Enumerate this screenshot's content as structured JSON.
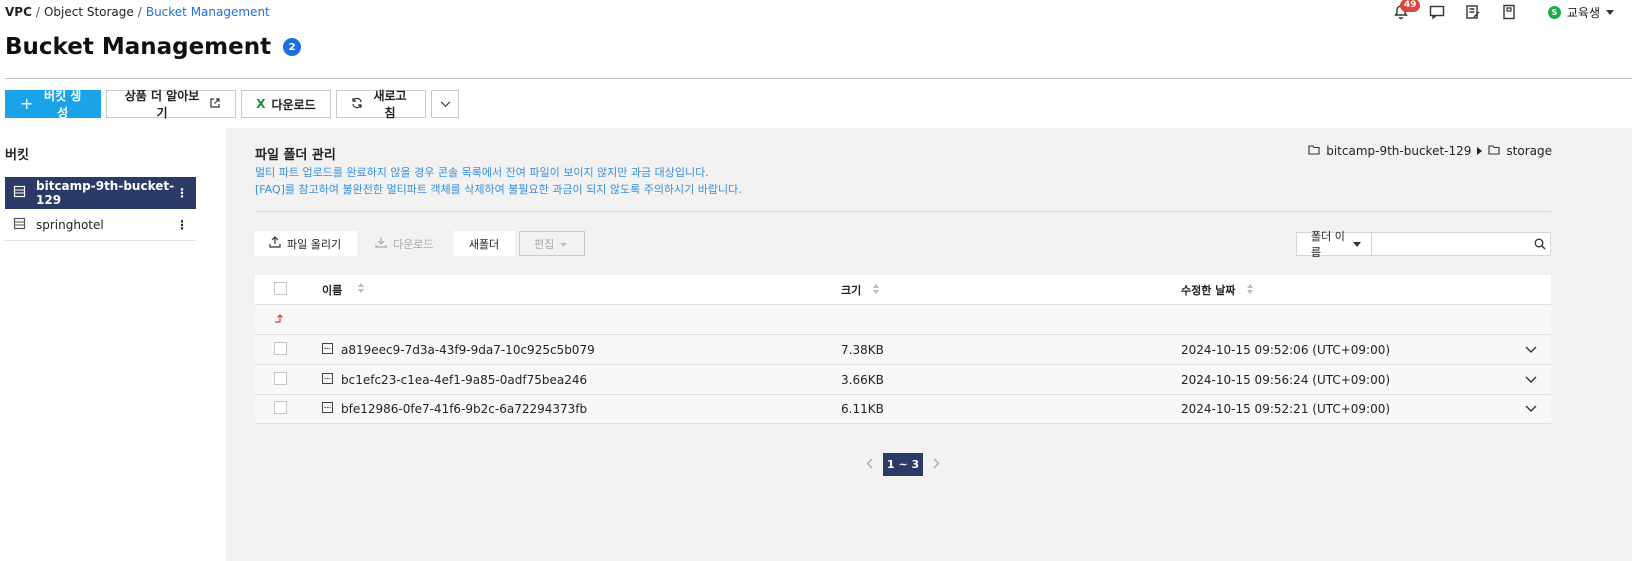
{
  "breadcrumb": [
    "VPC",
    "Object Storage",
    "Bucket Management"
  ],
  "header": {
    "notification_count": "49",
    "user_initial": "S",
    "user_name": "교육생"
  },
  "page": {
    "title": "Bucket Management",
    "badge": "2"
  },
  "toolbar": {
    "create": "버킷 생성",
    "learn_more": "상품 더 알아보기",
    "download": "다운로드",
    "refresh": "새로고침"
  },
  "sidebar": {
    "title": "버킷",
    "buckets": [
      {
        "name": "bitcamp-9th-bucket-129",
        "active": true
      },
      {
        "name": "springhotel",
        "active": false
      }
    ]
  },
  "main": {
    "section_title": "파일 폴더 관리",
    "notice_line1": "멀티 파트 업로드를 완료하지 않을 경우 콘솔 목록에서 잔여 파일이 보이지 않지만 과금 대상입니다.",
    "notice_line2": "[FAQ]를 참고하여 불완전한 멀티파트 객체를 삭제하여 불필요한 과금이 되지 않도록 주의하시기 바랍니다.",
    "path": [
      "bitcamp-9th-bucket-129",
      "storage"
    ],
    "actions": {
      "upload": "파일 올리기",
      "download": "다운로드",
      "new_folder": "새폴더",
      "edit": "편집"
    },
    "search": {
      "select": "폴더 이름",
      "value": ""
    },
    "table": {
      "headers": {
        "name": "이름",
        "size": "크기",
        "date": "수정한 날짜"
      },
      "rows": [
        {
          "name": "a819eec9-7d3a-43f9-9da7-10c925c5b079",
          "size": "7.38KB",
          "date": "2024-10-15 09:52:06 (UTC+09:00)"
        },
        {
          "name": "bc1efc23-c1ea-4ef1-9a85-0adf75bea246",
          "size": "3.66KB",
          "date": "2024-10-15 09:56:24 (UTC+09:00)"
        },
        {
          "name": "bfe12986-0fe7-41f6-9b2c-6a72294373fb",
          "size": "6.11KB",
          "date": "2024-10-15 09:52:21 (UTC+09:00)"
        }
      ]
    },
    "pager": "1 ~ 3"
  }
}
